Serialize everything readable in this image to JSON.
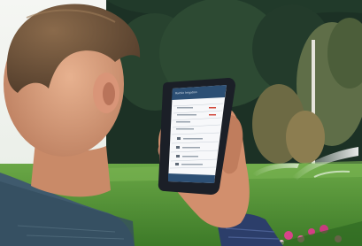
{
  "scene": {
    "subject": "person",
    "device": "smartphone",
    "setting": "park"
  },
  "phone_screen": {
    "header": "Rachio Irrigation",
    "rows": [
      "",
      "",
      "",
      "",
      ""
    ],
    "menu": [
      "",
      "",
      "",
      "",
      ""
    ]
  },
  "colors": {
    "sky": "#f2f4f1",
    "foliage_dark": "#1f3527",
    "grass": "#5f9c3a",
    "phone_body": "#1b1f27",
    "phone_header": "#2c4f74"
  }
}
